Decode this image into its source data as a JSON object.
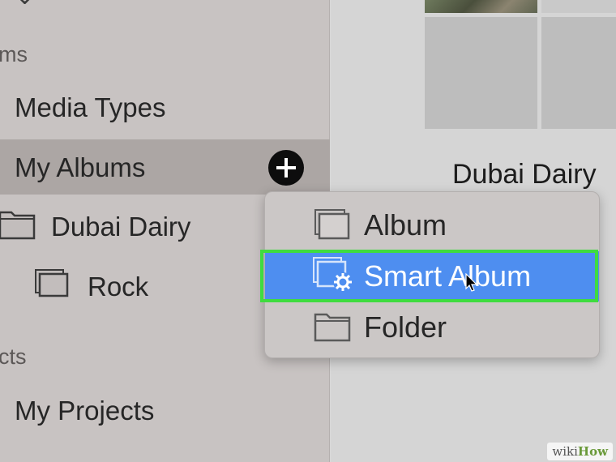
{
  "sidebar": {
    "section_albums": "ms",
    "items": {
      "media_types": "Media Types",
      "my_albums": "My Albums",
      "dubai_dairy": "Dubai Dairy",
      "rock": "Rock"
    },
    "section_projects": "cts",
    "my_projects": "My Projects"
  },
  "main": {
    "album_title": "Dubai Dairy"
  },
  "menu": {
    "album": "Album",
    "smart_album": "Smart Album",
    "folder": "Folder"
  },
  "colors": {
    "selection_blue": "#4e8ef0",
    "highlight_green": "#3fdc3f"
  },
  "watermark": {
    "wiki": "wiki",
    "how": "How"
  }
}
